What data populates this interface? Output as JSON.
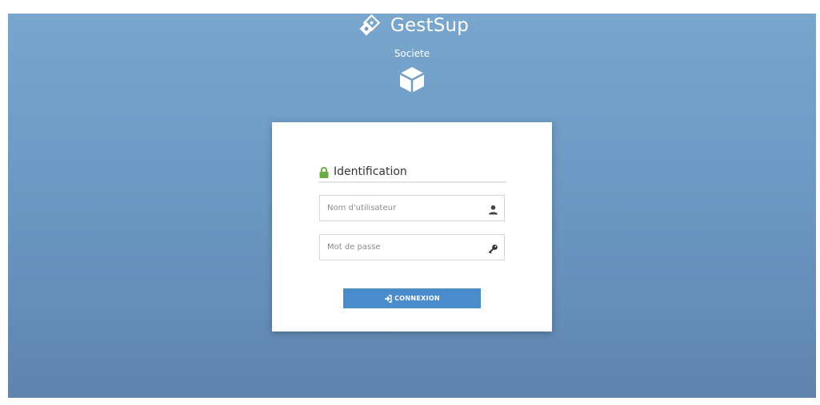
{
  "header": {
    "app_name": "GestSup",
    "company_name": "Societe",
    "logo_icon": "gestsup-logo-icon",
    "company_icon": "cube-icon"
  },
  "login_card": {
    "title": "Identification",
    "title_icon": "lock-icon",
    "username": {
      "placeholder": "Nom d'utilisateur",
      "value": "",
      "icon": "user-icon"
    },
    "password": {
      "placeholder": "Mot de passe",
      "value": "",
      "icon": "key-icon"
    },
    "submit_label": "CONNEXION",
    "submit_icon": "sign-in-icon"
  },
  "colors": {
    "background_top": "#78a6cd",
    "background_bottom": "#5f83ad",
    "accent": "#4a8ccc",
    "lock_green": "#69aa46"
  }
}
